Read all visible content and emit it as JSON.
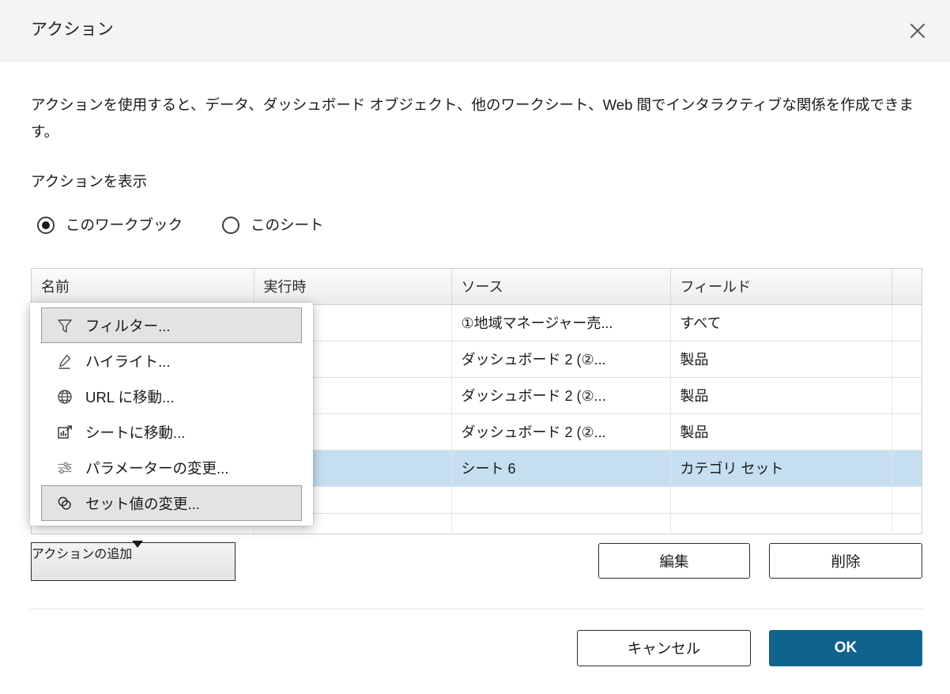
{
  "dialog": {
    "title": "アクション",
    "close_icon": "close-icon",
    "description": "アクションを使用すると、データ、ダッシュボード オブジェクト、他のワークシート、Web 間でインタラクティブな関係を作成できます。",
    "show_actions_label": "アクションを表示"
  },
  "scope_radios": {
    "options": [
      {
        "label": "このワークブック",
        "selected": true
      },
      {
        "label": "このシート",
        "selected": false
      }
    ]
  },
  "table": {
    "headers": [
      "名前",
      "実行時",
      "ソース",
      "フィールド",
      ""
    ],
    "rows": [
      {
        "name": "",
        "when": "",
        "source": "①地域マネージャー売...",
        "field": "すべて",
        "extra": "",
        "selected": false
      },
      {
        "name": "",
        "when": "",
        "source": "ダッシュボード 2 (②...",
        "field": "製品",
        "extra": "",
        "selected": false
      },
      {
        "name": "",
        "when": "",
        "source": "ダッシュボード 2 (②...",
        "field": "製品",
        "extra": "",
        "selected": false
      },
      {
        "name": "",
        "when": "",
        "source": "ダッシュボード 2 (②...",
        "field": "製品",
        "extra": "",
        "selected": false
      },
      {
        "name": "",
        "when": "",
        "source": "シート 6",
        "field": "カテゴリ セット",
        "extra": "",
        "selected": true
      },
      {
        "name": "",
        "when": "",
        "source": "",
        "field": "",
        "extra": "",
        "selected": false
      }
    ]
  },
  "menu": {
    "items": [
      {
        "label": "フィルター...",
        "icon": "filter-icon",
        "highlighted": true
      },
      {
        "label": "ハイライト...",
        "icon": "highlighter-icon",
        "highlighted": false
      },
      {
        "label": "URL に移動...",
        "icon": "globe-icon",
        "highlighted": false
      },
      {
        "label": "シートに移動...",
        "icon": "go-to-sheet-icon",
        "highlighted": false
      },
      {
        "label": "パラメーターの変更...",
        "icon": "sliders-icon",
        "highlighted": false
      },
      {
        "label": "セット値の変更...",
        "icon": "set-values-icon",
        "highlighted": true
      }
    ]
  },
  "buttons": {
    "add_action": "アクションの追加",
    "edit": "編集",
    "delete": "削除",
    "cancel": "キャンセル",
    "ok": "OK"
  },
  "colors": {
    "accent": "#11638f",
    "selected_row": "#c5dff1",
    "titlebar_bg": "#f4f4f4"
  }
}
